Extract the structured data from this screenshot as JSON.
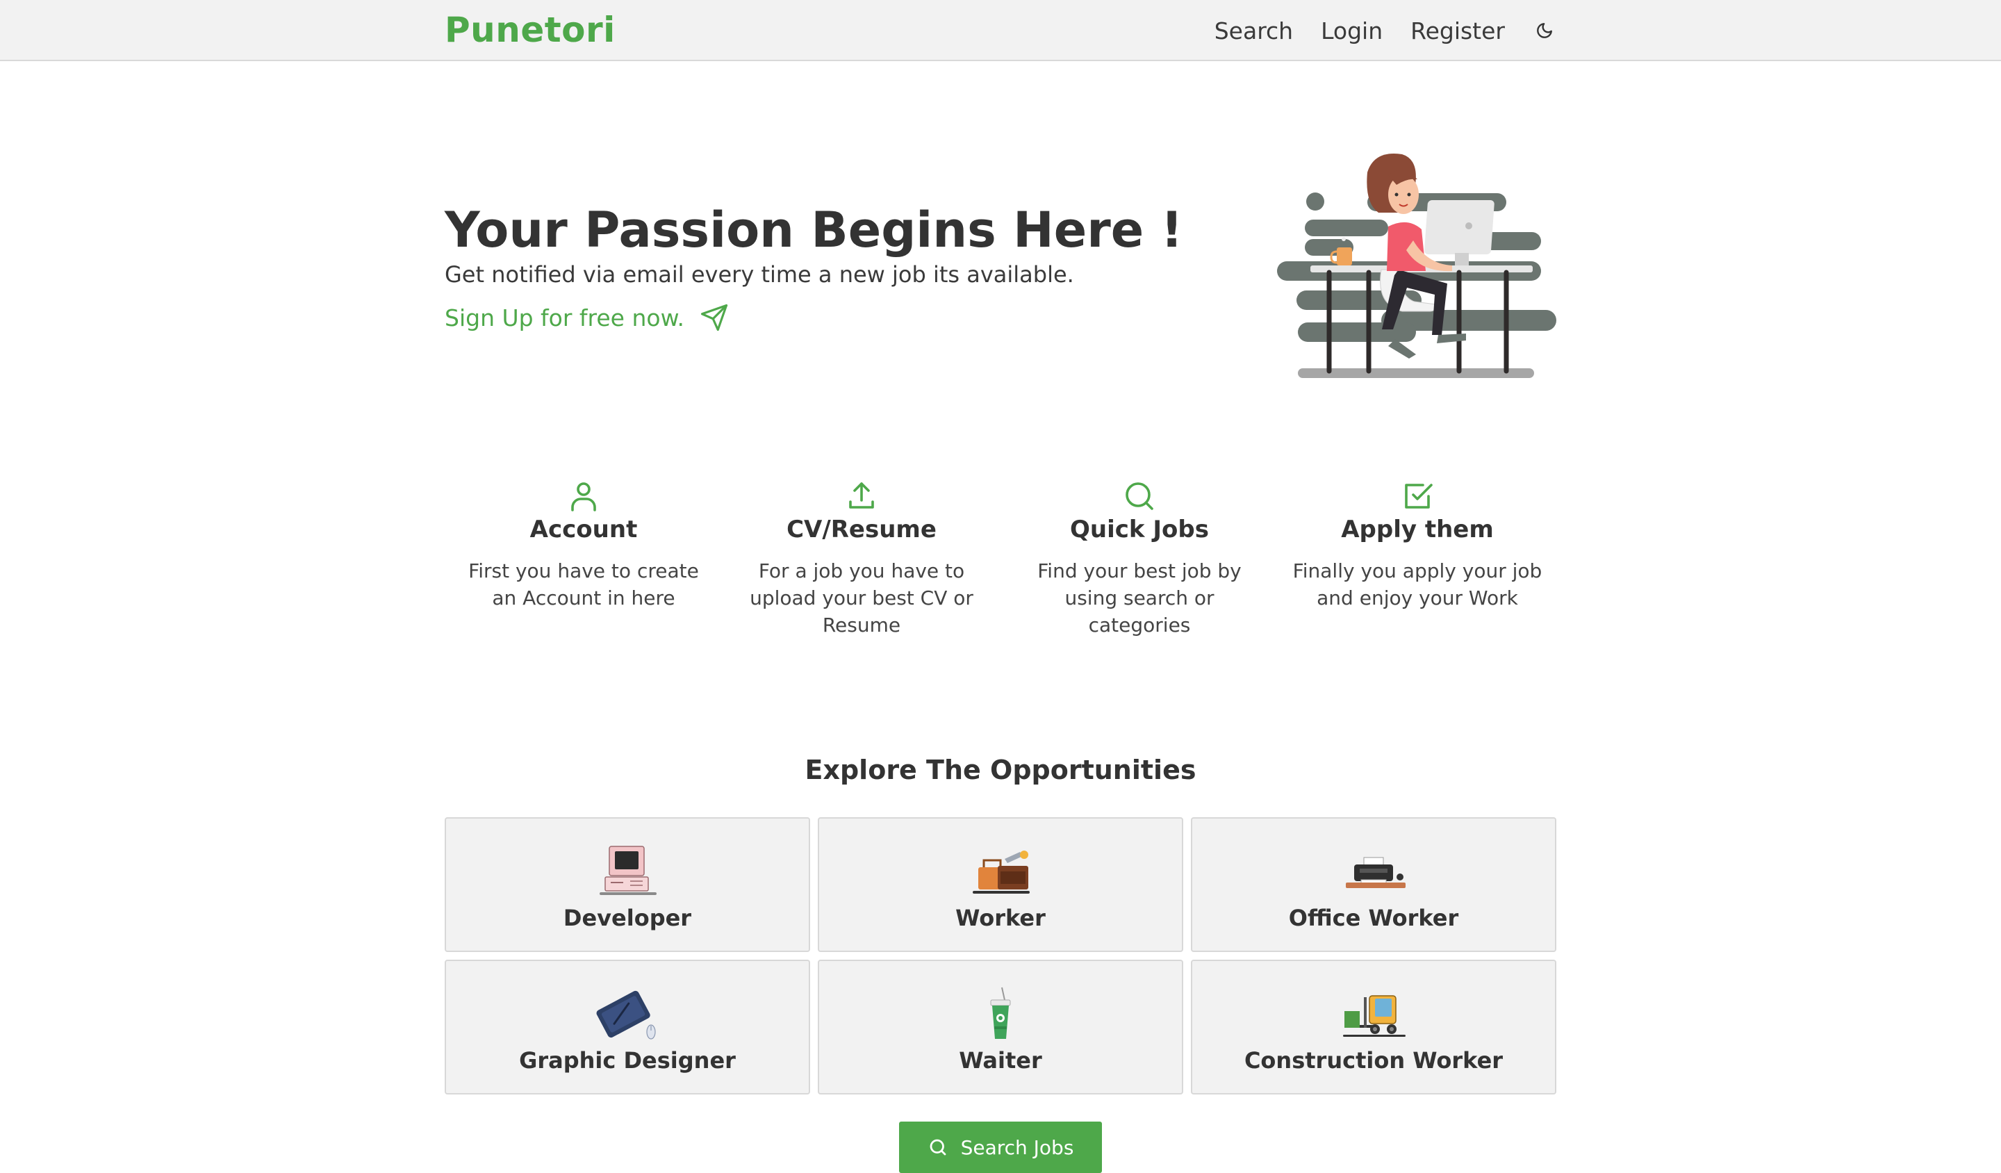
{
  "navbar": {
    "brand": "Punetori",
    "links": [
      {
        "label": "Search"
      },
      {
        "label": "Login"
      },
      {
        "label": "Register"
      }
    ],
    "theme_toggle_icon": "moon-icon"
  },
  "hero": {
    "title": "Your Passion Begins Here !",
    "subtitle": "Get notified via email every time a new job its available.",
    "cta_label": "Sign Up for free now.",
    "cta_icon": "send-icon"
  },
  "steps": [
    {
      "icon": "user-icon",
      "title": "Account",
      "description": "First you have to create an Account in here"
    },
    {
      "icon": "upload-icon",
      "title": "CV/Resume",
      "description": "For a job you have to upload your best CV or Resume"
    },
    {
      "icon": "search-icon",
      "title": "Quick Jobs",
      "description": "Find your best job by using search or categories"
    },
    {
      "icon": "check-square-icon",
      "title": "Apply them",
      "description": "Finally you apply your job and enjoy your Work"
    }
  ],
  "categories_section": {
    "title": "Explore The Opportunities",
    "items": [
      {
        "label": "Developer",
        "icon": "computer-icon"
      },
      {
        "label": "Worker",
        "icon": "toolbox-icon"
      },
      {
        "label": "Office Worker",
        "icon": "printer-icon"
      },
      {
        "label": "Graphic Designer",
        "icon": "drawing-tablet-icon"
      },
      {
        "label": "Waiter",
        "icon": "coffee-cup-icon"
      },
      {
        "label": "Construction Worker",
        "icon": "forklift-icon"
      }
    ],
    "search_button_label": "Search Jobs"
  },
  "colors": {
    "accent": "#4ea84a",
    "navbar_bg": "#f2f2f2",
    "card_bg": "#f2f2f2",
    "text": "#333333"
  }
}
